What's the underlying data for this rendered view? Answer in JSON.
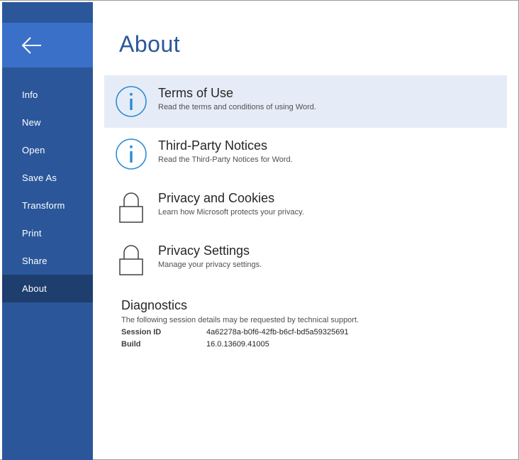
{
  "sidebar": {
    "back_icon": "arrow-left-icon",
    "items": [
      {
        "label": "Info"
      },
      {
        "label": "New"
      },
      {
        "label": "Open"
      },
      {
        "label": "Save As"
      },
      {
        "label": "Transform"
      },
      {
        "label": "Print"
      },
      {
        "label": "Share"
      },
      {
        "label": "About",
        "active": true
      }
    ]
  },
  "main": {
    "title": "About",
    "tiles": [
      {
        "icon": "info-icon",
        "title": "Terms of Use",
        "desc": "Read the terms and conditions of using Word."
      },
      {
        "icon": "info-icon",
        "title": "Third-Party Notices",
        "desc": "Read the Third-Party Notices for Word."
      },
      {
        "icon": "lock-icon",
        "title": "Privacy and Cookies",
        "desc": "Learn how Microsoft protects your privacy."
      },
      {
        "icon": "lock-icon",
        "title": "Privacy Settings",
        "desc": "Manage your privacy settings."
      }
    ],
    "diagnostics": {
      "title": "Diagnostics",
      "desc": "The following session details may be requested by technical support.",
      "rows": [
        {
          "key": "Session ID",
          "value": "4a62278a-b0f6-42fb-b6cf-bd5a59325691"
        },
        {
          "key": "Build",
          "value": "16.0.13609.41005"
        }
      ]
    }
  },
  "colors": {
    "sidebar": "#2b579a",
    "back_button": "#3a70c8",
    "active_item": "#1e3e6e",
    "accent": "#2b579a",
    "tile_hover": "#e6ecf7",
    "info_icon": "#2b8bd6"
  }
}
